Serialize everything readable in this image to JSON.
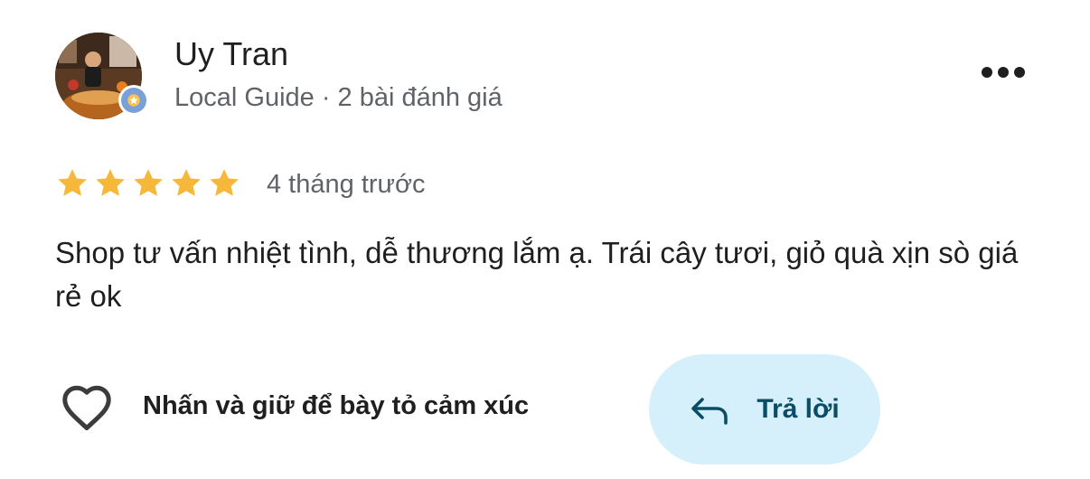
{
  "review": {
    "author": {
      "name": "Uy Tran",
      "meta": "Local Guide · 2 bài đánh giá",
      "avatar_icon": "user-avatar-photo",
      "badge_icon": "local-guide-star-icon"
    },
    "more_icon": "more-horizontal-icon",
    "rating": {
      "value": 5,
      "max": 5,
      "star_color": "#f6b83b"
    },
    "time": "4 tháng trước",
    "text": "Shop tư vấn nhiệt tình, dễ thương lắm ạ. Trái cây tươi, giỏ quà xịn sò giá rẻ ok"
  },
  "actions": {
    "react_label": "Nhấn và giữ để bày tỏ cảm xúc",
    "react_icon": "heart-outline-icon",
    "reply_label": "Trả lời",
    "reply_icon": "reply-arrow-icon",
    "reply_bg": "#d6f0fb",
    "reply_color": "#0b4d66"
  }
}
